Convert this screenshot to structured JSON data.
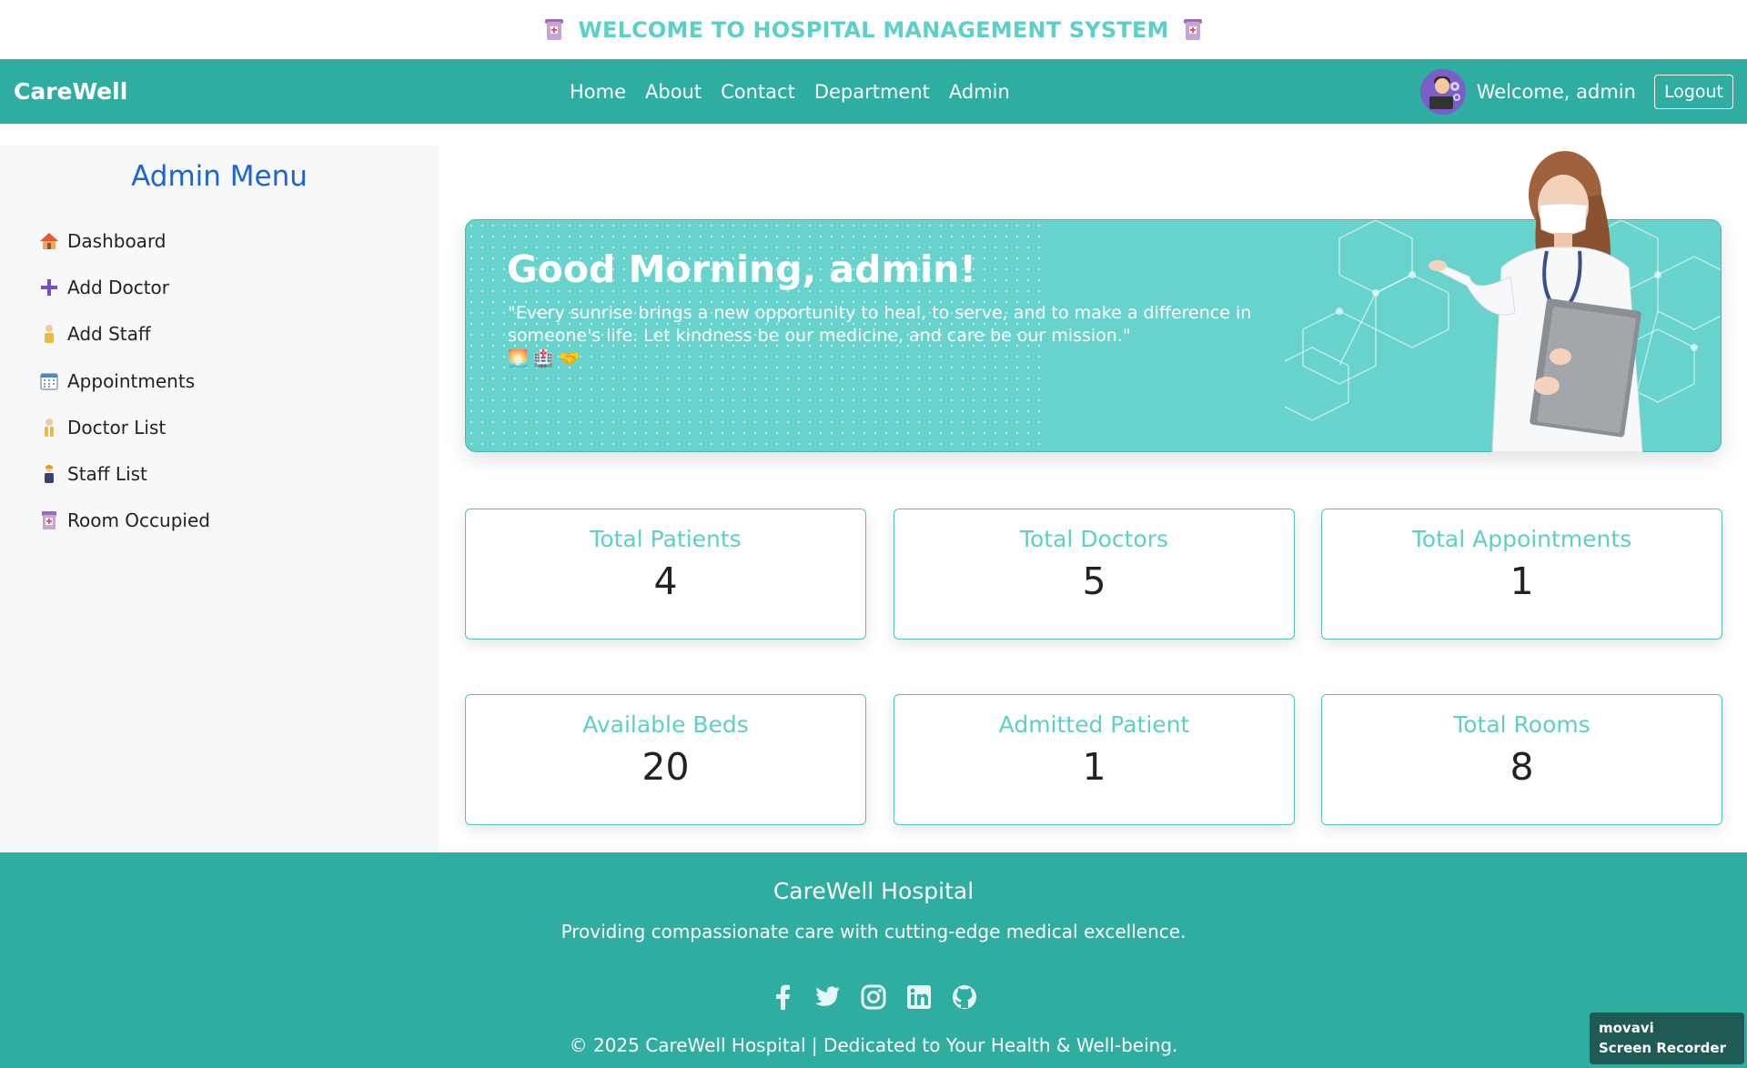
{
  "banner": {
    "title": "WELCOME TO HOSPITAL MANAGEMENT SYSTEM",
    "icon": "hospital-icon"
  },
  "navbar": {
    "brand": "CareWell",
    "links": [
      "Home",
      "About",
      "Contact",
      "Department",
      "Admin"
    ],
    "welcome": "Welcome, admin",
    "logout": "Logout",
    "color": "#2fada1"
  },
  "sidebar": {
    "title": "Admin Menu",
    "items": [
      {
        "label": "Dashboard",
        "icon": "house-icon"
      },
      {
        "label": "Add Doctor",
        "icon": "plus-icon"
      },
      {
        "label": "Add Staff",
        "icon": "staff-person-icon"
      },
      {
        "label": "Appointments",
        "icon": "calendar-icon"
      },
      {
        "label": "Doctor List",
        "icon": "doctor-person-icon"
      },
      {
        "label": "Staff List",
        "icon": "staff-person-icon"
      },
      {
        "label": "Room Occupied",
        "icon": "hospital-icon"
      }
    ]
  },
  "greeting": {
    "heading": "Good Morning, admin!",
    "quote": "\"Every sunrise brings a new opportunity to heal, to serve, and to make a difference in someone's life. Let kindness be our medicine, and care be our mission.\"",
    "emojis": [
      "🌅",
      "🏥",
      "🤝"
    ]
  },
  "stats": [
    {
      "label": "Total Patients",
      "value": "4"
    },
    {
      "label": "Total Doctors",
      "value": "5"
    },
    {
      "label": "Total Appointments",
      "value": "1"
    },
    {
      "label": "Available Beds",
      "value": "20"
    },
    {
      "label": "Admitted Patient",
      "value": "1"
    },
    {
      "label": "Total Rooms",
      "value": "8"
    }
  ],
  "footer": {
    "title": "CareWell Hospital",
    "tagline": "Providing compassionate care with cutting-edge medical excellence.",
    "socials": [
      "facebook-icon",
      "twitter-icon",
      "instagram-icon",
      "linkedin-icon",
      "github-icon"
    ],
    "copyright": "© 2025 CareWell Hospital | Dedicated to Your Health & Well-being."
  },
  "watermark": {
    "line1": "movavi",
    "line2": "Screen Recorder"
  }
}
